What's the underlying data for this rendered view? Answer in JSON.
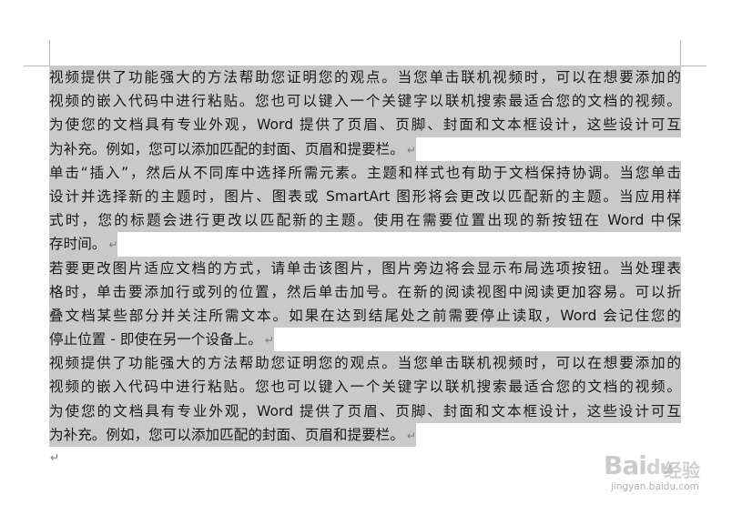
{
  "document": {
    "paragraphs": [
      {
        "lines": [
          "视频提供了功能强大的方法帮助您证明您的观点。当您单击联机视频时，可以在想要添加的",
          "视频的嵌入代码中进行粘贴。您也可以键入一个关键字以联机搜索最适合您的文档的视频。",
          "为使您的文档具有专业外观，Word 提供了页眉、页脚、封面和文本框设计，这些设计可互",
          "为补充。例如，您可以添加匹配的封面、页眉和提要栏。"
        ]
      },
      {
        "lines": [
          "单击“插入”，然后从不同库中选择所需元素。主题和样式也有助于文档保持协调。当您单击",
          "设计并选择新的主题时，图片、图表或 SmartArt 图形将会更改以匹配新的主题。当应用样",
          "式时，您的标题会进行更改以匹配新的主题。使用在需要位置出现的新按钮在 Word 中保",
          "存时间。"
        ]
      },
      {
        "lines": [
          "若要更改图片适应文档的方式，请单击该图片，图片旁边将会显示布局选项按钮。当处理表",
          "格时，单击要添加行或列的位置，然后单击加号。在新的阅读视图中阅读更加容易。可以折",
          "叠文档某些部分并关注所需文本。如果在达到结尾处之前需要停止读取，Word 会记住您的",
          "停止位置 - 即使在另一个设备上。"
        ]
      },
      {
        "lines": [
          "视频提供了功能强大的方法帮助您证明您的观点。当您单击联机视频时，可以在想要添加的",
          "视频的嵌入代码中进行粘贴。您也可以键入一个关键字以联机搜索最适合您的文档的视频。",
          "为使您的文档具有专业外观，Word 提供了页眉、页脚、封面和文本框设计，这些设计可互",
          "为补充。例如，您可以添加匹配的封面、页眉和提要栏。"
        ]
      }
    ],
    "paragraph_mark": "↵",
    "selection_color": "#c9c9c9"
  },
  "watermark": {
    "logo_text": "Bai",
    "logo_paw": "du",
    "chinese": "经验",
    "url": "jingyan.baidu.com"
  }
}
